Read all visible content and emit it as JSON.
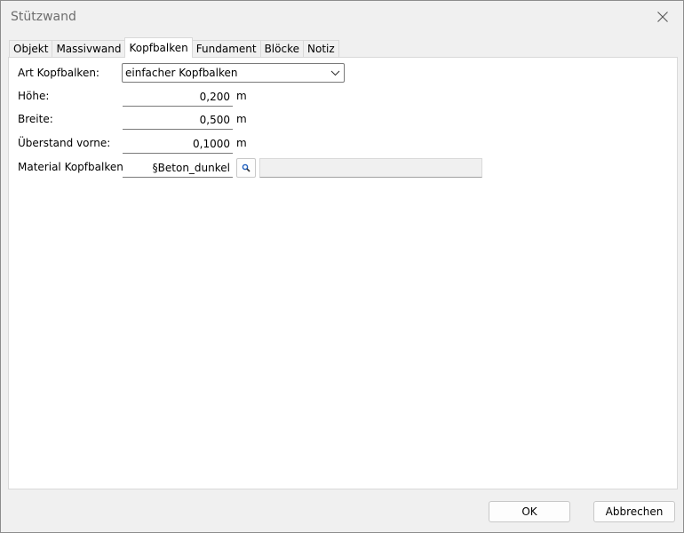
{
  "window": {
    "title": "Stützwand"
  },
  "tabs": [
    {
      "label": "Objekt",
      "active": false
    },
    {
      "label": "Massivwand",
      "active": false
    },
    {
      "label": "Kopfbalken",
      "active": true
    },
    {
      "label": "Fundament",
      "active": false
    },
    {
      "label": "Blöcke",
      "active": false
    },
    {
      "label": "Notiz",
      "active": false
    }
  ],
  "form": {
    "art": {
      "label": "Art Kopfbalken:",
      "value": "einfacher Kopfbalken"
    },
    "hoehe": {
      "label": "Höhe:",
      "value": "0,200",
      "unit": "m"
    },
    "breite": {
      "label": "Breite:",
      "value": "0,500",
      "unit": "m"
    },
    "ueberstand": {
      "label": "Überstand vorne:",
      "value": "0,1000",
      "unit": "m"
    },
    "material": {
      "label": "Material Kopfbalken",
      "value": "§Beton_dunkel",
      "preview": ""
    }
  },
  "buttons": {
    "ok": "OK",
    "cancel": "Abbrechen"
  },
  "icons": {
    "close": "close-icon",
    "dropdown": "chevron-down-icon",
    "search": "search-icon"
  },
  "colors": {
    "window_bg": "#f0f0f0",
    "panel_bg": "#ffffff",
    "title_text": "#6d6d6d",
    "search_icon_blue": "#1f5fbf"
  }
}
